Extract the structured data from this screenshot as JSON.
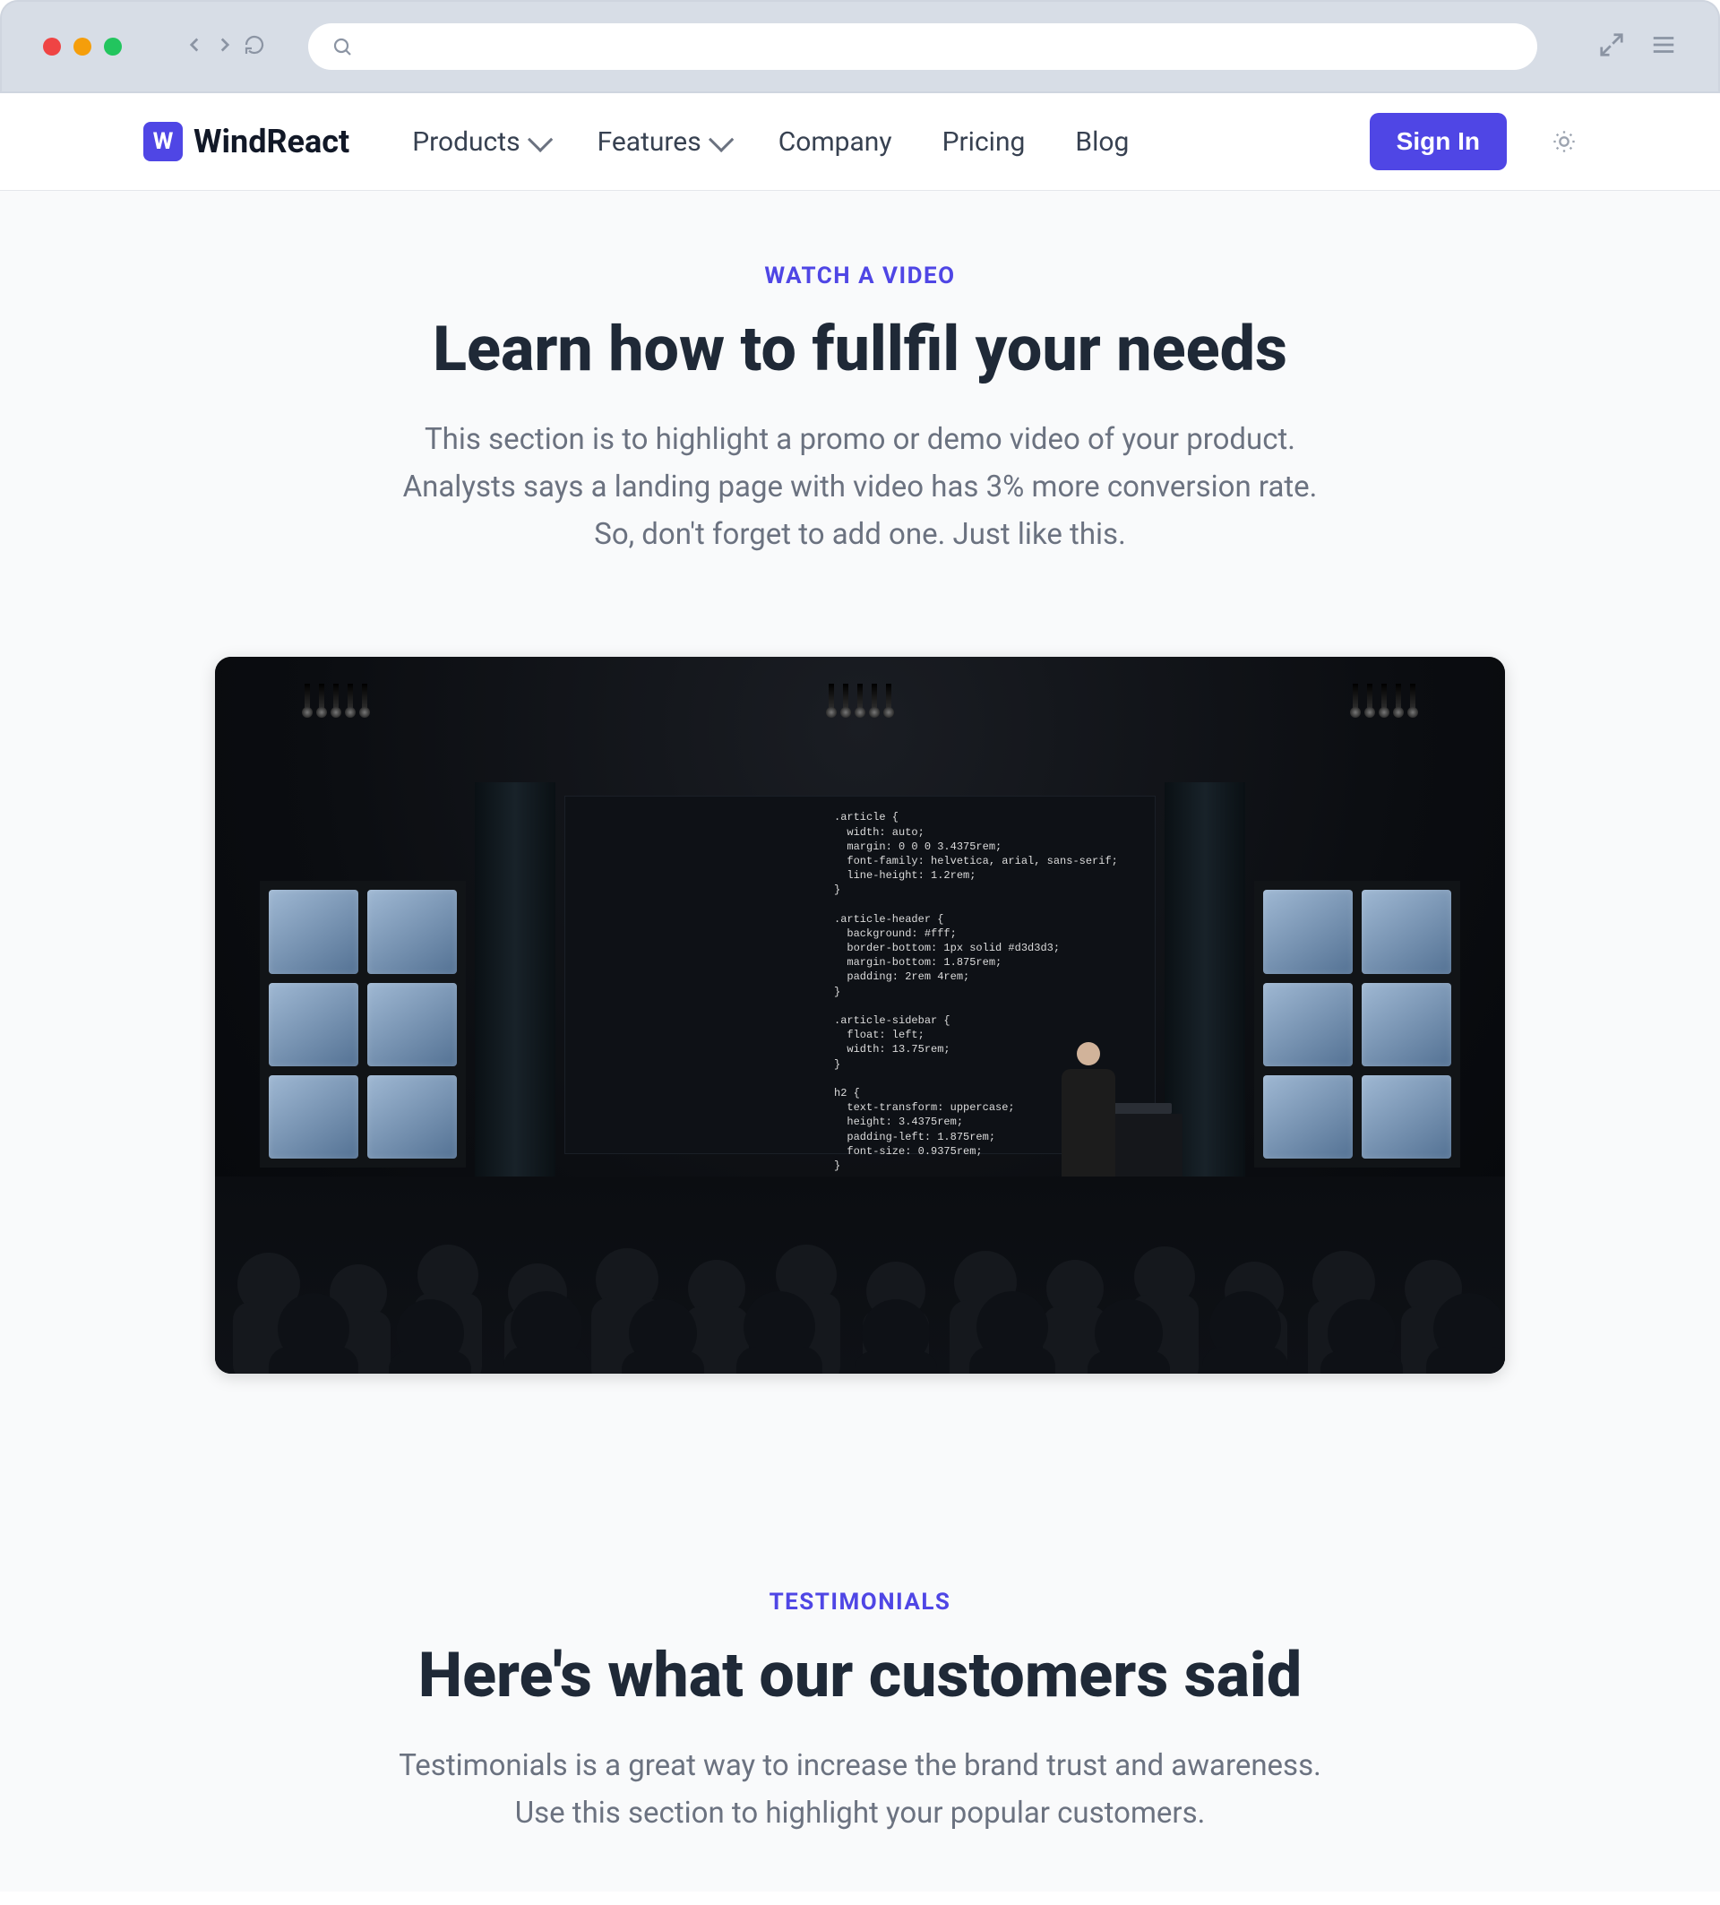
{
  "brand": {
    "name": "WindReact",
    "mark": "W"
  },
  "nav": {
    "products": "Products",
    "features": "Features",
    "company": "Company",
    "pricing": "Pricing",
    "blog": "Blog"
  },
  "header": {
    "sign_in": "Sign In"
  },
  "video_section": {
    "eyebrow": "WATCH A VIDEO",
    "title": "Learn how to fullfil your needs",
    "desc_line1": "This section is to highlight a promo or demo video of your product.",
    "desc_line2": "Analysts says a landing page with video has 3% more conversion rate.",
    "desc_line3": "So, don't forget to add one. Just like this.",
    "code": ".article {\n  width: auto;\n  margin: 0 0 0 3.4375rem;\n  font-family: helvetica, arial, sans-serif;\n  line-height: 1.2rem;\n}\n\n.article-header {\n  background: #fff;\n  border-bottom: 1px solid #d3d3d3;\n  margin-bottom: 1.875rem;\n  padding: 2rem 4rem;\n}\n\n.article-sidebar {\n  float: left;\n  width: 13.75rem;\n}\n\nh2 {\n  text-transform: uppercase;\n  height: 3.4375rem;\n  padding-left: 1.875rem;\n  font-size: 0.9375rem;\n}"
  },
  "testimonials_section": {
    "eyebrow": "TESTIMONIALS",
    "title": "Here's what our customers said",
    "desc_line1": "Testimonials is a great way to increase the brand trust and awareness.",
    "desc_line2": "Use this section to highlight your popular customers."
  }
}
